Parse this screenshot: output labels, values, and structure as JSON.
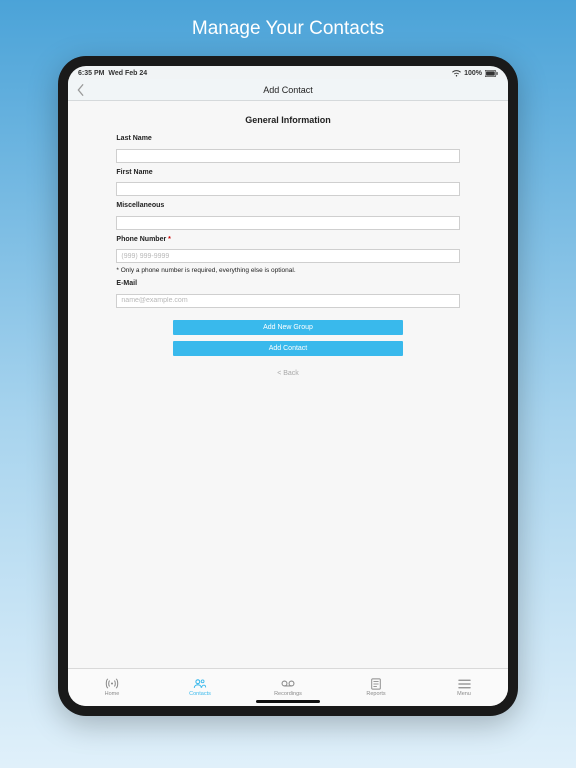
{
  "hero": {
    "title": "Manage Your Contacts"
  },
  "status": {
    "time": "6:35 PM",
    "date": "Wed Feb 24",
    "battery": "100%"
  },
  "nav": {
    "title": "Add Contact"
  },
  "section": {
    "title": "General Information"
  },
  "form": {
    "last_name": {
      "label": "Last Name",
      "value": ""
    },
    "first_name": {
      "label": "First Name",
      "value": ""
    },
    "misc": {
      "label": "Miscellaneous",
      "value": ""
    },
    "phone": {
      "label": "Phone Number ",
      "req": "*",
      "placeholder": "(999) 999-9999",
      "value": ""
    },
    "hint": "* Only a phone number is required, everything else is optional.",
    "email": {
      "label": "E-Mail",
      "placeholder": "name@example.com",
      "value": ""
    }
  },
  "buttons": {
    "add_group": "Add New Group",
    "add_contact": "Add Contact",
    "back": "< Back"
  },
  "tabs": {
    "home": "Home",
    "contacts": "Contacts",
    "recordings": "Recordings",
    "reports": "Reports",
    "menu": "Menu"
  }
}
